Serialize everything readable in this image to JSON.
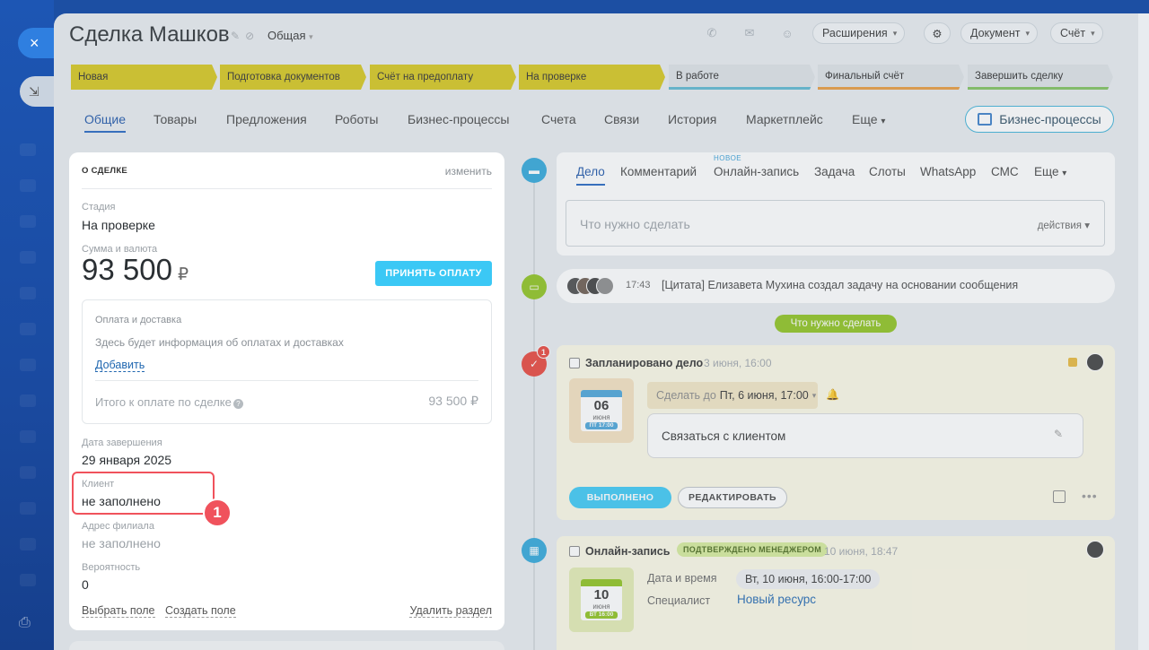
{
  "window": {
    "close_icon": "×",
    "pin_icon": "⇲",
    "print_icon": "⎙"
  },
  "header": {
    "title": "Сделка Машков",
    "category": "Общая",
    "extensions": "Расширения",
    "document": "Документ",
    "invoice": "Счёт"
  },
  "stages": [
    {
      "label": "Новая"
    },
    {
      "label": "Подготовка документов"
    },
    {
      "label": "Счёт на предоплату"
    },
    {
      "label": "На проверке"
    },
    {
      "label": "В работе"
    },
    {
      "label": "Финальный счёт"
    },
    {
      "label": "Завершить сделку"
    }
  ],
  "tabs": [
    "Общие",
    "Товары",
    "Предложения",
    "Роботы",
    "Бизнес-процессы",
    "Счета",
    "Связи",
    "История",
    "Маркетплейс",
    "Еще"
  ],
  "bp_button": "Бизнес-процессы",
  "about": {
    "header": "О СДЕЛКЕ",
    "edit": "изменить",
    "stage_label": "Стадия",
    "stage_value": "На проверке",
    "sum_label": "Сумма и валюта",
    "sum_value": "93 500",
    "currency": "₽",
    "pay_button": "ПРИНЯТЬ ОПЛАТУ",
    "paybox": {
      "title": "Оплата и доставка",
      "info": "Здесь будет информация об оплатах и доставках",
      "add": "Добавить",
      "total_label": "Итого к оплате по сделке",
      "total_value": "93 500 ₽"
    },
    "close_label": "Дата завершения",
    "close_value": "29 января 2025",
    "client_label": "Клиент",
    "client_value": "не заполнено",
    "branch_label": "Адрес филиала",
    "branch_value": "не заполнено",
    "prob_label": "Вероятность",
    "prob_value": "0",
    "choose_field": "Выбрать поле",
    "create_field": "Создать поле",
    "delete_section": "Удалить раздел",
    "marker": "1"
  },
  "activity": {
    "tabs": [
      "Дело",
      "Комментарий",
      "Онлайн-запись",
      "Задача",
      "Слоты",
      "WhatsApp",
      "СМС",
      "Еще"
    ],
    "new_badge": "НОВОЕ",
    "placeholder": "Что нужно сделать",
    "actions": "действия"
  },
  "feed": {
    "time": "17:43",
    "message": "[Цитата] Елизавета Мухина создал задачу на основании сообщения"
  },
  "todo_pill": "Что нужно сделать",
  "task1": {
    "badge": "1",
    "title": "Запланировано дело",
    "date": "3 июня, 16:00",
    "cal_day": "06",
    "cal_month": "июня",
    "cal_week": "ПТ 17:00",
    "deadline_prefix": "Сделать до",
    "deadline_value": "Пт, 6 июня, 17:00",
    "text": "Связаться с клиентом",
    "done": "ВЫПОЛНЕНО",
    "edit": "РЕДАКТИРОВАТЬ"
  },
  "task2": {
    "title": "Онлайн-запись",
    "badge": "ПОДТВЕРЖДЕНО МЕНЕДЖЕРОМ",
    "date": "10 июня, 18:47",
    "cal_day": "10",
    "cal_month": "июня",
    "cal_week": "ВТ 16:00",
    "dt_label": "Дата и время",
    "dt_value": "Вт, 10 июня, 16:00-17:00",
    "spec_label": "Специалист",
    "spec_value": "Новый ресурс"
  }
}
